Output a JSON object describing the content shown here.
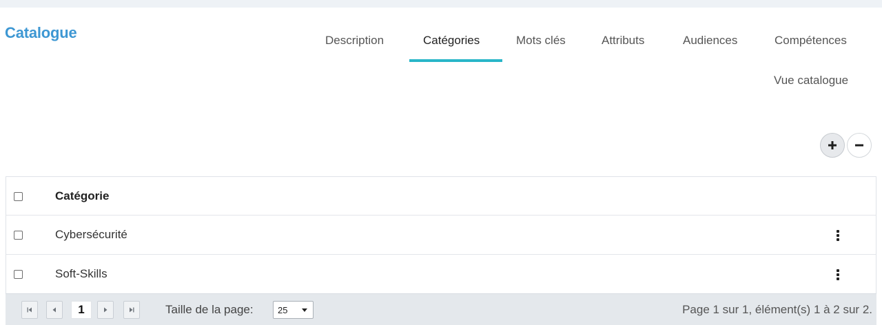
{
  "header": {
    "title": "Catalogue"
  },
  "tabs": [
    {
      "label": "Description",
      "active": false
    },
    {
      "label": "Catégories",
      "active": true
    },
    {
      "label": "Mots clés",
      "active": false
    },
    {
      "label": "Attributs",
      "active": false
    },
    {
      "label": "Audiences",
      "active": false
    },
    {
      "label": "Compétences",
      "active": false
    },
    {
      "label": "Vue catalogue",
      "active": false
    }
  ],
  "actions": {
    "expand_icon": "plus-icon",
    "collapse_icon": "minus-icon"
  },
  "grid": {
    "columns": [
      "Catégorie"
    ],
    "rows": [
      {
        "name": "Cybersécurité"
      },
      {
        "name": "Soft-Skills"
      }
    ]
  },
  "pager": {
    "current_page": "1",
    "page_size_label": "Taille de la page:",
    "page_size": "25",
    "info": "Page 1 sur 1, élément(s) 1 à 2 sur 2."
  },
  "colors": {
    "accent": "#29b6c8",
    "title": "#3d97d3",
    "pager_bg": "#e4e8ec"
  }
}
